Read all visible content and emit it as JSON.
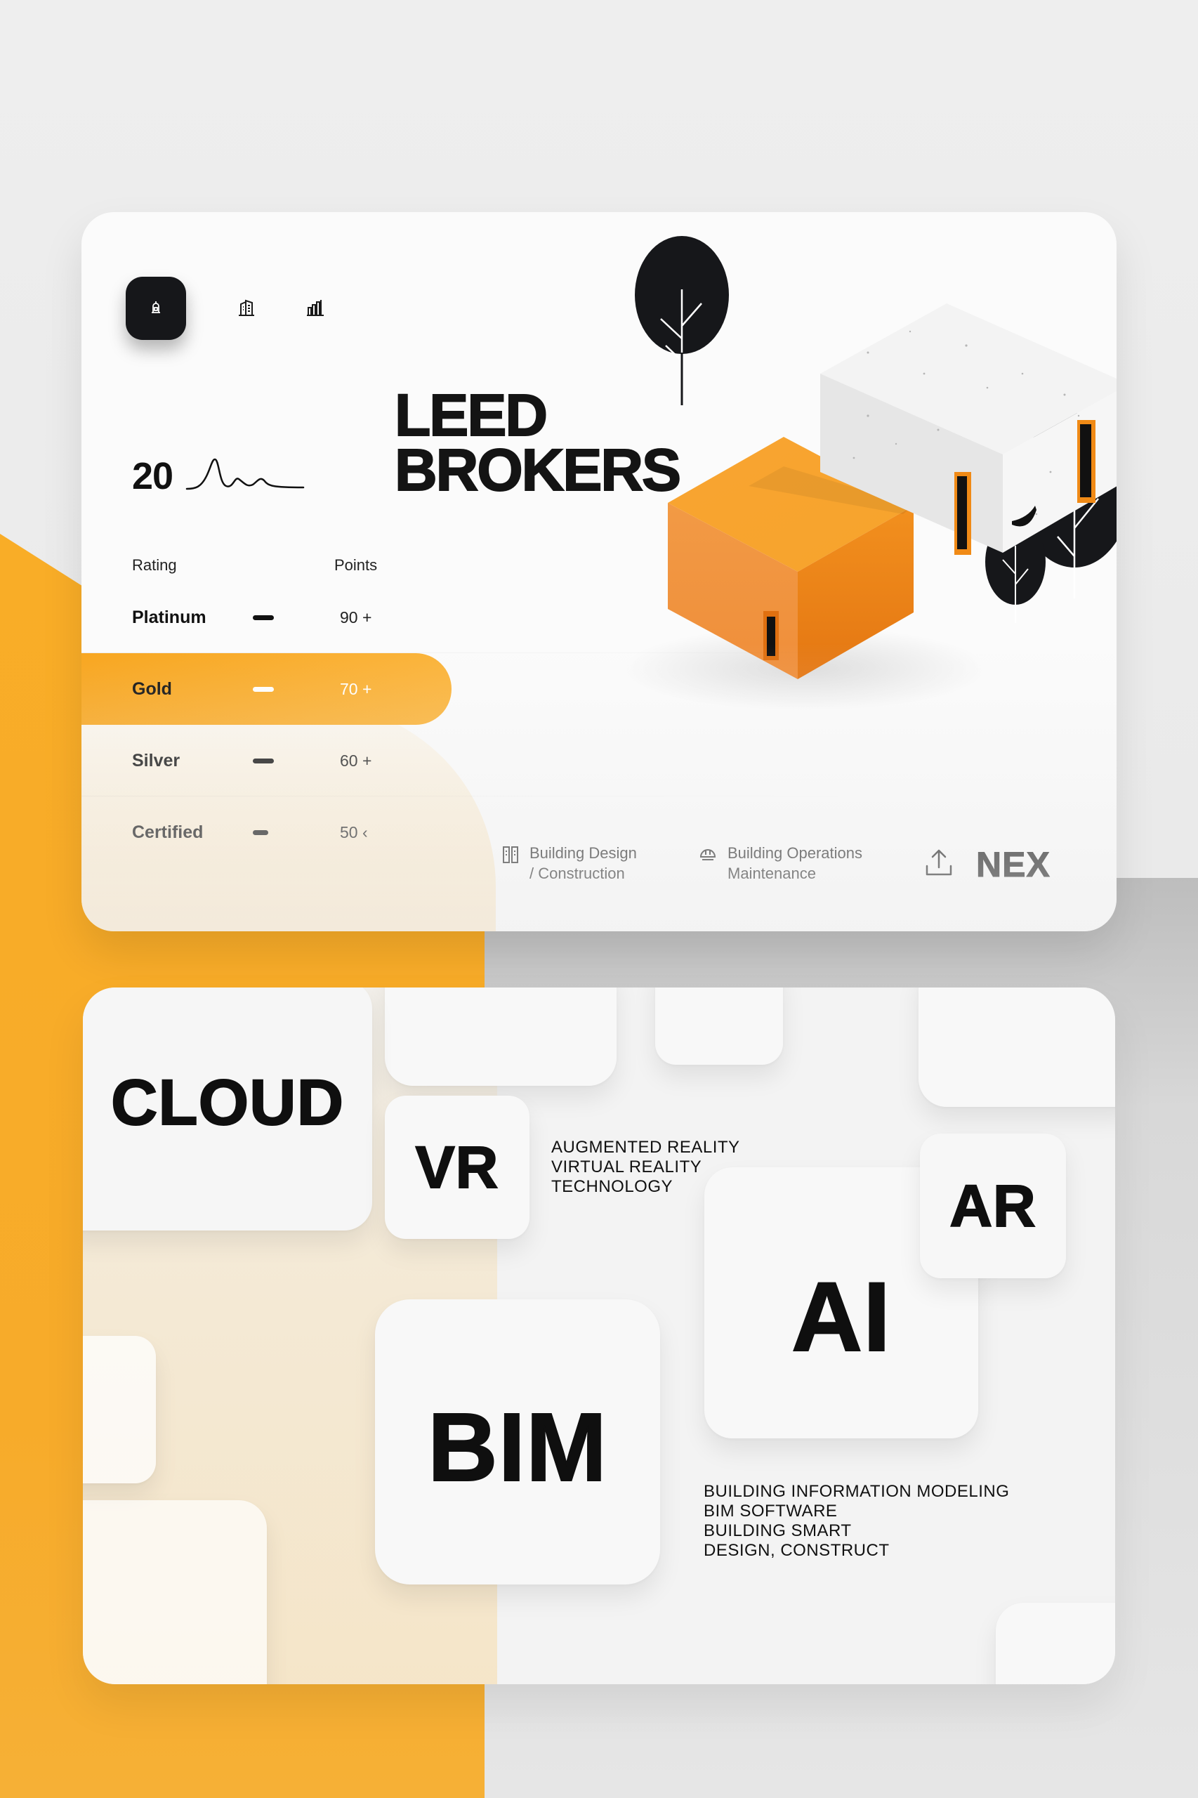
{
  "headline": {
    "line1": "LEED",
    "line2": "BROKERS"
  },
  "stat": {
    "value": "20"
  },
  "nav": {
    "tabs": [
      {
        "icon": "building-bell-icon",
        "active": true
      },
      {
        "icon": "office-building-icon",
        "active": false
      },
      {
        "icon": "city-skyline-icon",
        "active": false
      }
    ]
  },
  "table": {
    "header_rating": "Rating",
    "header_points": "Points",
    "rows": [
      {
        "name": "Platinum",
        "points": "90 +"
      },
      {
        "name": "Gold",
        "points": "70 +",
        "highlighted": true
      },
      {
        "name": "Silver",
        "points": "60 +"
      },
      {
        "name": "Certified",
        "points": "50 ‹"
      }
    ]
  },
  "footer": {
    "design_line1": "Building Design",
    "design_line2": "/ Construction",
    "operations_line1": "Building Operations",
    "operations_line2": "Maintenance",
    "action_label": "NEX"
  },
  "tech": {
    "cloud": "CLOUD",
    "vr": "VR",
    "ar": "AR",
    "ai": "AI",
    "bim": "BIM",
    "ar_vr_caption": [
      "AUGMENTED REALITY",
      "VIRTUAL REALITY",
      "TECHNOLOGY"
    ],
    "bim_caption": [
      "BUILDING INFORMATION MODELING",
      "BIM SOFTWARE",
      "BUILDING SMART",
      "DESIGN, CONSTRUCT"
    ]
  },
  "colors": {
    "accent": "#F9A51F",
    "dark": "#16171A",
    "card": "#FBFBFB"
  }
}
